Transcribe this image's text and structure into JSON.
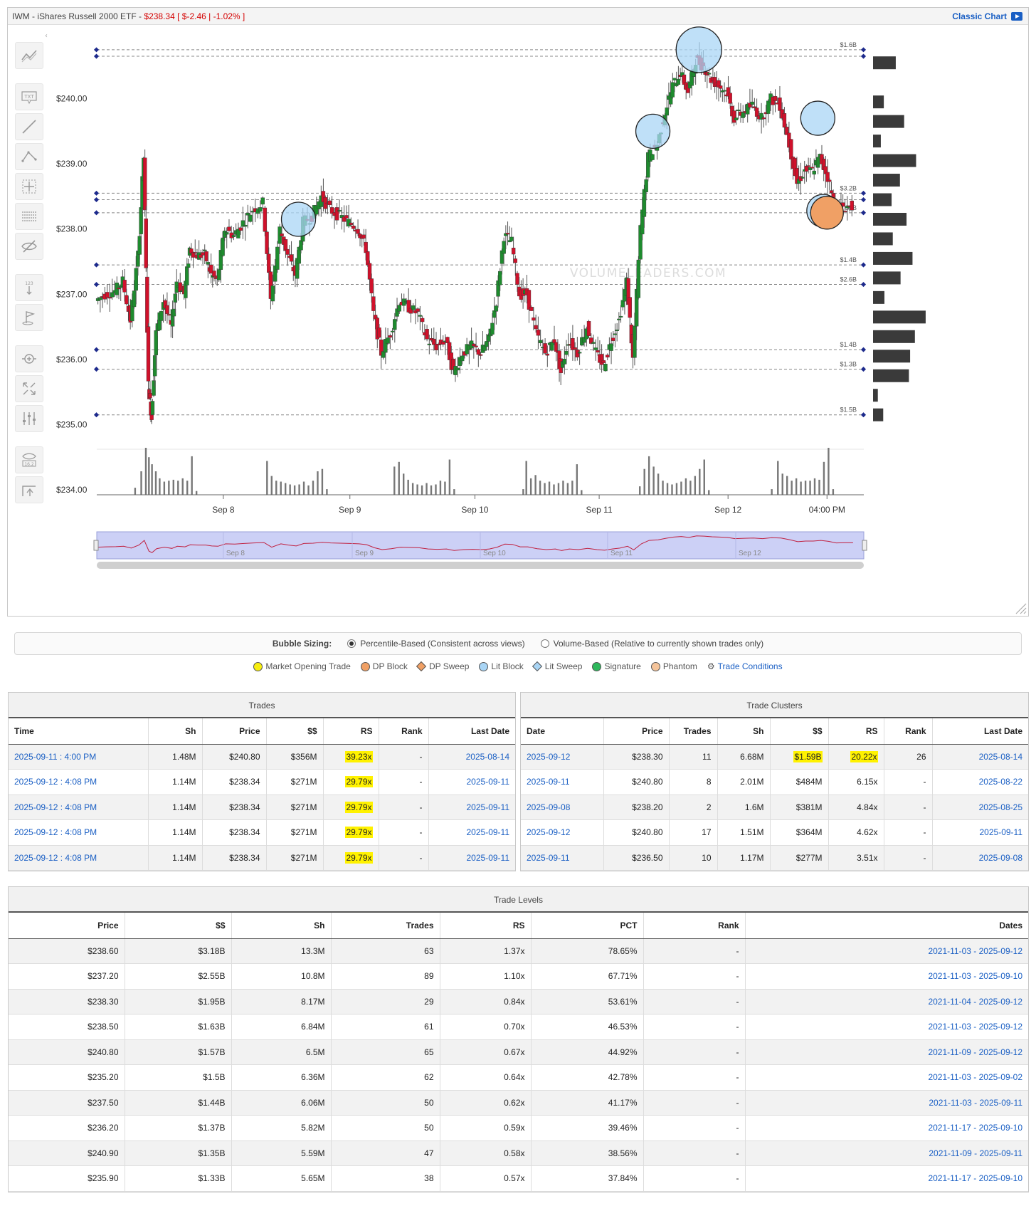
{
  "header": {
    "ticker": "IWM - iShares Russell 2000 ETF -",
    "quote": "$238.34 [ $-2.46 | -1.02% ]",
    "classic_chart": "Classic Chart"
  },
  "toolbar": {
    "icons": [
      "trend-icon",
      "text-tool-icon",
      "line-tool-icon",
      "abc-pattern-icon",
      "crosshair-box-icon",
      "horizontal-lines-icon",
      "hide-drawings-icon",
      "measure-icon",
      "flag-icon",
      "zoom-icon",
      "fullscreen-icon",
      "sliders-icon",
      "eye-value-icon",
      "screenshot-icon"
    ],
    "txt_label": "TXT",
    "measure_label": "123",
    "eye_label": "16.2"
  },
  "watermark": "VOLUMELEADERS.COM",
  "chart_data": {
    "type": "candlestick",
    "y_ticks": [
      "$240.00",
      "$239.00",
      "$238.00",
      "$237.00",
      "$236.00",
      "$235.00",
      "$234.00"
    ],
    "y_tick_values": [
      240,
      239,
      238,
      237,
      236,
      235,
      234
    ],
    "ylim": [
      234,
      241
    ],
    "x_ticks": [
      "Sep 8",
      "Sep 9",
      "Sep 10",
      "Sep 11",
      "Sep 12",
      "04:00 PM"
    ],
    "navigator_ticks": [
      "Sep 8",
      "Sep 9",
      "Sep 10",
      "Sep 11",
      "Sep 12"
    ],
    "colors": {
      "up": "#1e8b2e",
      "down": "#d0112b",
      "bubble_lit": "#a9d5f5",
      "bubble_dp": "#f0a065",
      "level_line": "#888888",
      "level_marker": "#1d2a8c"
    },
    "level_lines": [
      {
        "price": 240.75,
        "label": "$1.6B"
      },
      {
        "price": 240.65,
        "label": ""
      },
      {
        "price": 238.55,
        "label": "$3.2B"
      },
      {
        "price": 238.45,
        "label": ""
      },
      {
        "price": 238.25,
        "label": "$2B"
      },
      {
        "price": 237.45,
        "label": "$1.4B"
      },
      {
        "price": 237.15,
        "label": "$2.6B"
      },
      {
        "price": 236.15,
        "label": "$1.4B"
      },
      {
        "price": 235.85,
        "label": "$1.3B"
      },
      {
        "price": 235.15,
        "label": "$1.5B"
      }
    ],
    "bubbles": [
      {
        "x_frac": 0.263,
        "price": 238.15,
        "r": 24,
        "kind": "lit"
      },
      {
        "x_frac": 0.725,
        "price": 239.5,
        "r": 24,
        "kind": "lit"
      },
      {
        "x_frac": 0.785,
        "price": 240.75,
        "r": 32,
        "kind": "lit"
      },
      {
        "x_frac": 0.94,
        "price": 239.7,
        "r": 24,
        "kind": "lit"
      },
      {
        "x_frac": 0.947,
        "price": 238.28,
        "r": 23,
        "kind": "lit"
      },
      {
        "x_frac": 0.952,
        "price": 238.25,
        "r": 23,
        "kind": "dp"
      }
    ],
    "volume_profile": [
      {
        "price": 240.55,
        "value": 0.38
      },
      {
        "price": 239.95,
        "value": 0.18
      },
      {
        "price": 239.65,
        "value": 0.52
      },
      {
        "price": 239.35,
        "value": 0.13
      },
      {
        "price": 239.05,
        "value": 0.72
      },
      {
        "price": 238.75,
        "value": 0.45
      },
      {
        "price": 238.45,
        "value": 0.31
      },
      {
        "price": 238.15,
        "value": 0.56
      },
      {
        "price": 237.85,
        "value": 0.33
      },
      {
        "price": 237.55,
        "value": 0.66
      },
      {
        "price": 237.25,
        "value": 0.46
      },
      {
        "price": 236.95,
        "value": 0.19
      },
      {
        "price": 236.65,
        "value": 0.88
      },
      {
        "price": 236.35,
        "value": 0.7
      },
      {
        "price": 236.05,
        "value": 0.62
      },
      {
        "price": 235.75,
        "value": 0.6
      },
      {
        "price": 235.45,
        "value": 0.08
      },
      {
        "price": 235.15,
        "value": 0.17
      }
    ],
    "price_path": [
      [
        0.0,
        236.9
      ],
      [
        0.012,
        237.0
      ],
      [
        0.025,
        237.05
      ],
      [
        0.035,
        237.2
      ],
      [
        0.045,
        236.6
      ],
      [
        0.055,
        237.6
      ],
      [
        0.062,
        239.1
      ],
      [
        0.068,
        235.6
      ],
      [
        0.072,
        235.1
      ],
      [
        0.078,
        236.4
      ],
      [
        0.088,
        236.9
      ],
      [
        0.098,
        236.5
      ],
      [
        0.105,
        237.2
      ],
      [
        0.115,
        237.0
      ],
      [
        0.122,
        237.7
      ],
      [
        0.132,
        237.6
      ],
      [
        0.142,
        237.6
      ],
      [
        0.15,
        237.3
      ],
      [
        0.158,
        237.2
      ],
      [
        0.168,
        238.0
      ],
      [
        0.18,
        237.9
      ],
      [
        0.192,
        238.1
      ],
      [
        0.205,
        238.3
      ],
      [
        0.218,
        238.4
      ],
      [
        0.228,
        236.9
      ],
      [
        0.24,
        238.0
      ],
      [
        0.25,
        237.6
      ],
      [
        0.26,
        237.3
      ],
      [
        0.27,
        238.1
      ],
      [
        0.282,
        238.2
      ],
      [
        0.294,
        238.5
      ],
      [
        0.305,
        238.3
      ],
      [
        0.318,
        238.2
      ],
      [
        0.33,
        238.1
      ],
      [
        0.342,
        238.0
      ],
      [
        0.352,
        237.7
      ],
      [
        0.362,
        236.7
      ],
      [
        0.372,
        236.1
      ],
      [
        0.384,
        236.4
      ],
      [
        0.396,
        236.9
      ],
      [
        0.408,
        236.8
      ],
      [
        0.42,
        236.7
      ],
      [
        0.432,
        236.3
      ],
      [
        0.444,
        236.2
      ],
      [
        0.456,
        236.3
      ],
      [
        0.466,
        235.8
      ],
      [
        0.478,
        236.1
      ],
      [
        0.49,
        236.2
      ],
      [
        0.502,
        236.1
      ],
      [
        0.512,
        236.3
      ],
      [
        0.522,
        236.9
      ],
      [
        0.532,
        237.9
      ],
      [
        0.542,
        237.8
      ],
      [
        0.552,
        237.0
      ],
      [
        0.562,
        237.0
      ],
      [
        0.574,
        236.4
      ],
      [
        0.586,
        236.1
      ],
      [
        0.598,
        236.3
      ],
      [
        0.606,
        235.8
      ],
      [
        0.616,
        236.3
      ],
      [
        0.628,
        236.1
      ],
      [
        0.64,
        236.5
      ],
      [
        0.652,
        236.1
      ],
      [
        0.662,
        235.9
      ],
      [
        0.672,
        236.3
      ],
      [
        0.682,
        236.6
      ],
      [
        0.692,
        237.2
      ],
      [
        0.7,
        236.0
      ],
      [
        0.71,
        238.0
      ],
      [
        0.72,
        239.1
      ],
      [
        0.732,
        239.3
      ],
      [
        0.742,
        239.8
      ],
      [
        0.752,
        240.2
      ],
      [
        0.762,
        240.4
      ],
      [
        0.772,
        240.1
      ],
      [
        0.782,
        240.6
      ],
      [
        0.792,
        240.5
      ],
      [
        0.802,
        240.3
      ],
      [
        0.812,
        240.2
      ],
      [
        0.822,
        240.1
      ],
      [
        0.832,
        239.7
      ],
      [
        0.844,
        239.8
      ],
      [
        0.856,
        239.9
      ],
      [
        0.868,
        239.7
      ],
      [
        0.88,
        240.0
      ],
      [
        0.892,
        239.9
      ],
      [
        0.904,
        239.3
      ],
      [
        0.914,
        238.7
      ],
      [
        0.924,
        238.9
      ],
      [
        0.934,
        238.9
      ],
      [
        0.944,
        239.1
      ],
      [
        0.954,
        238.8
      ],
      [
        0.964,
        238.3
      ],
      [
        0.974,
        238.35
      ],
      [
        0.986,
        238.34
      ]
    ],
    "volume_bars": [
      {
        "x_frac": 0.05,
        "value": 0.15
      },
      {
        "x_frac": 0.058,
        "value": 0.5
      },
      {
        "x_frac": 0.064,
        "value": 1.0
      },
      {
        "x_frac": 0.068,
        "value": 0.8
      },
      {
        "x_frac": 0.072,
        "value": 0.65
      },
      {
        "x_frac": 0.077,
        "value": 0.5
      },
      {
        "x_frac": 0.082,
        "value": 0.35
      },
      {
        "x_frac": 0.088,
        "value": 0.28
      },
      {
        "x_frac": 0.094,
        "value": 0.3
      },
      {
        "x_frac": 0.1,
        "value": 0.32
      },
      {
        "x_frac": 0.106,
        "value": 0.3
      },
      {
        "x_frac": 0.112,
        "value": 0.35
      },
      {
        "x_frac": 0.118,
        "value": 0.3
      },
      {
        "x_frac": 0.124,
        "value": 0.82
      },
      {
        "x_frac": 0.13,
        "value": 0.08
      },
      {
        "x_frac": 0.222,
        "value": 0.72
      },
      {
        "x_frac": 0.228,
        "value": 0.4
      },
      {
        "x_frac": 0.234,
        "value": 0.3
      },
      {
        "x_frac": 0.24,
        "value": 0.28
      },
      {
        "x_frac": 0.246,
        "value": 0.25
      },
      {
        "x_frac": 0.252,
        "value": 0.22
      },
      {
        "x_frac": 0.258,
        "value": 0.2
      },
      {
        "x_frac": 0.264,
        "value": 0.22
      },
      {
        "x_frac": 0.27,
        "value": 0.28
      },
      {
        "x_frac": 0.276,
        "value": 0.2
      },
      {
        "x_frac": 0.282,
        "value": 0.3
      },
      {
        "x_frac": 0.288,
        "value": 0.5
      },
      {
        "x_frac": 0.294,
        "value": 0.55
      },
      {
        "x_frac": 0.3,
        "value": 0.12
      },
      {
        "x_frac": 0.388,
        "value": 0.6
      },
      {
        "x_frac": 0.394,
        "value": 0.7
      },
      {
        "x_frac": 0.4,
        "value": 0.45
      },
      {
        "x_frac": 0.406,
        "value": 0.32
      },
      {
        "x_frac": 0.412,
        "value": 0.25
      },
      {
        "x_frac": 0.418,
        "value": 0.22
      },
      {
        "x_frac": 0.424,
        "value": 0.2
      },
      {
        "x_frac": 0.43,
        "value": 0.25
      },
      {
        "x_frac": 0.436,
        "value": 0.2
      },
      {
        "x_frac": 0.442,
        "value": 0.22
      },
      {
        "x_frac": 0.448,
        "value": 0.3
      },
      {
        "x_frac": 0.454,
        "value": 0.28
      },
      {
        "x_frac": 0.46,
        "value": 0.75
      },
      {
        "x_frac": 0.466,
        "value": 0.12
      },
      {
        "x_frac": 0.556,
        "value": 0.12
      },
      {
        "x_frac": 0.56,
        "value": 0.72
      },
      {
        "x_frac": 0.566,
        "value": 0.35
      },
      {
        "x_frac": 0.572,
        "value": 0.42
      },
      {
        "x_frac": 0.578,
        "value": 0.3
      },
      {
        "x_frac": 0.584,
        "value": 0.25
      },
      {
        "x_frac": 0.59,
        "value": 0.28
      },
      {
        "x_frac": 0.596,
        "value": 0.22
      },
      {
        "x_frac": 0.602,
        "value": 0.25
      },
      {
        "x_frac": 0.608,
        "value": 0.3
      },
      {
        "x_frac": 0.614,
        "value": 0.25
      },
      {
        "x_frac": 0.62,
        "value": 0.3
      },
      {
        "x_frac": 0.626,
        "value": 0.65
      },
      {
        "x_frac": 0.632,
        "value": 0.1
      },
      {
        "x_frac": 0.708,
        "value": 0.18
      },
      {
        "x_frac": 0.714,
        "value": 0.55
      },
      {
        "x_frac": 0.72,
        "value": 0.82
      },
      {
        "x_frac": 0.726,
        "value": 0.6
      },
      {
        "x_frac": 0.732,
        "value": 0.45
      },
      {
        "x_frac": 0.738,
        "value": 0.3
      },
      {
        "x_frac": 0.744,
        "value": 0.25
      },
      {
        "x_frac": 0.75,
        "value": 0.22
      },
      {
        "x_frac": 0.756,
        "value": 0.25
      },
      {
        "x_frac": 0.762,
        "value": 0.28
      },
      {
        "x_frac": 0.768,
        "value": 0.35
      },
      {
        "x_frac": 0.774,
        "value": 0.3
      },
      {
        "x_frac": 0.78,
        "value": 0.4
      },
      {
        "x_frac": 0.786,
        "value": 0.55
      },
      {
        "x_frac": 0.792,
        "value": 0.75
      },
      {
        "x_frac": 0.798,
        "value": 0.1
      },
      {
        "x_frac": 0.88,
        "value": 0.12
      },
      {
        "x_frac": 0.888,
        "value": 0.72
      },
      {
        "x_frac": 0.894,
        "value": 0.45
      },
      {
        "x_frac": 0.9,
        "value": 0.4
      },
      {
        "x_frac": 0.906,
        "value": 0.3
      },
      {
        "x_frac": 0.912,
        "value": 0.35
      },
      {
        "x_frac": 0.918,
        "value": 0.28
      },
      {
        "x_frac": 0.924,
        "value": 0.3
      },
      {
        "x_frac": 0.93,
        "value": 0.3
      },
      {
        "x_frac": 0.936,
        "value": 0.35
      },
      {
        "x_frac": 0.942,
        "value": 0.32
      },
      {
        "x_frac": 0.948,
        "value": 0.7
      },
      {
        "x_frac": 0.954,
        "value": 1.0
      },
      {
        "x_frac": 0.96,
        "value": 0.12
      }
    ]
  },
  "bubble_sizing": {
    "label": "Bubble Sizing:",
    "option1": "Percentile-Based (Consistent across views)",
    "option2": "Volume-Based (Relative to currently shown trades only)"
  },
  "legend": [
    {
      "label": "Market Opening Trade",
      "color": "#f7ee10",
      "shape": "circle"
    },
    {
      "label": "DP Block",
      "color": "#f0a065",
      "shape": "circle"
    },
    {
      "label": "DP Sweep",
      "color": "#f0a065",
      "shape": "diamond"
    },
    {
      "label": "Lit Block",
      "color": "#a9d5f5",
      "shape": "circle"
    },
    {
      "label": "Lit Sweep",
      "color": "#a9d5f5",
      "shape": "diamond"
    },
    {
      "label": "Signature",
      "color": "#2eb85c",
      "shape": "circle"
    },
    {
      "label": "Phantom",
      "color": "#f5c49a",
      "shape": "circle"
    }
  ],
  "trade_conditions_label": "Trade Conditions",
  "trades": {
    "title": "Trades",
    "headers": [
      "Time",
      "Sh",
      "Price",
      "$$",
      "RS",
      "Rank",
      "Last Date"
    ],
    "rows": [
      [
        "2025-09-11 : 4:00 PM",
        "1.48M",
        "$240.80",
        "$356M",
        "39.23x",
        "-",
        "2025-08-14"
      ],
      [
        "2025-09-12 : 4:08 PM",
        "1.14M",
        "$238.34",
        "$271M",
        "29.79x",
        "-",
        "2025-09-11"
      ],
      [
        "2025-09-12 : 4:08 PM",
        "1.14M",
        "$238.34",
        "$271M",
        "29.79x",
        "-",
        "2025-09-11"
      ],
      [
        "2025-09-12 : 4:08 PM",
        "1.14M",
        "$238.34",
        "$271M",
        "29.79x",
        "-",
        "2025-09-11"
      ],
      [
        "2025-09-12 : 4:08 PM",
        "1.14M",
        "$238.34",
        "$271M",
        "29.79x",
        "-",
        "2025-09-11"
      ]
    ]
  },
  "clusters": {
    "title": "Trade Clusters",
    "headers": [
      "Date",
      "Price",
      "Trades",
      "Sh",
      "$$",
      "RS",
      "Rank",
      "Last Date"
    ],
    "rows": [
      [
        "2025-09-12",
        "$238.30",
        "11",
        "6.68M",
        "$1.59B",
        "20.22x",
        "26",
        "2025-08-14"
      ],
      [
        "2025-09-11",
        "$240.80",
        "8",
        "2.01M",
        "$484M",
        "6.15x",
        "-",
        "2025-08-22"
      ],
      [
        "2025-09-08",
        "$238.20",
        "2",
        "1.6M",
        "$381M",
        "4.84x",
        "-",
        "2025-08-25"
      ],
      [
        "2025-09-12",
        "$240.80",
        "17",
        "1.51M",
        "$364M",
        "4.62x",
        "-",
        "2025-09-11"
      ],
      [
        "2025-09-11",
        "$236.50",
        "10",
        "1.17M",
        "$277M",
        "3.51x",
        "-",
        "2025-09-08"
      ]
    ]
  },
  "levels": {
    "title": "Trade Levels",
    "headers": [
      "Price",
      "$$",
      "Sh",
      "Trades",
      "RS",
      "PCT",
      "Rank",
      "Dates"
    ],
    "rows": [
      [
        "$238.60",
        "$3.18B",
        "13.3M",
        "63",
        "1.37x",
        "78.65%",
        "-",
        "2021-11-03 - 2025-09-12"
      ],
      [
        "$237.20",
        "$2.55B",
        "10.8M",
        "89",
        "1.10x",
        "67.71%",
        "-",
        "2021-11-03 - 2025-09-10"
      ],
      [
        "$238.30",
        "$1.95B",
        "8.17M",
        "29",
        "0.84x",
        "53.61%",
        "-",
        "2021-11-04 - 2025-09-12"
      ],
      [
        "$238.50",
        "$1.63B",
        "6.84M",
        "61",
        "0.70x",
        "46.53%",
        "-",
        "2021-11-03 - 2025-09-12"
      ],
      [
        "$240.80",
        "$1.57B",
        "6.5M",
        "65",
        "0.67x",
        "44.92%",
        "-",
        "2021-11-09 - 2025-09-12"
      ],
      [
        "$235.20",
        "$1.5B",
        "6.36M",
        "62",
        "0.64x",
        "42.78%",
        "-",
        "2021-11-03 - 2025-09-02"
      ],
      [
        "$237.50",
        "$1.44B",
        "6.06M",
        "50",
        "0.62x",
        "41.17%",
        "-",
        "2021-11-03 - 2025-09-11"
      ],
      [
        "$236.20",
        "$1.37B",
        "5.82M",
        "50",
        "0.59x",
        "39.46%",
        "-",
        "2021-11-17 - 2025-09-10"
      ],
      [
        "$240.90",
        "$1.35B",
        "5.59M",
        "47",
        "0.58x",
        "38.56%",
        "-",
        "2021-11-09 - 2025-09-11"
      ],
      [
        "$235.90",
        "$1.33B",
        "5.65M",
        "38",
        "0.57x",
        "37.84%",
        "-",
        "2021-11-17 - 2025-09-10"
      ]
    ]
  }
}
